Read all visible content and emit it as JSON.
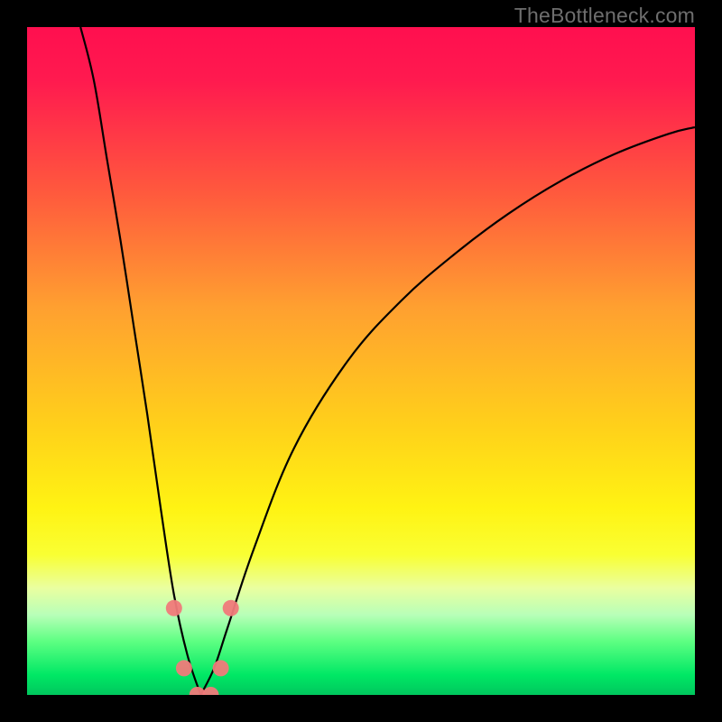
{
  "watermark": "TheBottleneck.com",
  "chart_data": {
    "type": "line",
    "title": "",
    "xlabel": "",
    "ylabel": "",
    "xlim": [
      0,
      100
    ],
    "ylim": [
      0,
      100
    ],
    "curve_type": "bottleneck-v-curve",
    "min_point_percent": 26,
    "left_branch": [
      {
        "x": 8,
        "y": 100
      },
      {
        "x": 10,
        "y": 92
      },
      {
        "x": 12,
        "y": 80
      },
      {
        "x": 14,
        "y": 68
      },
      {
        "x": 16,
        "y": 55
      },
      {
        "x": 18,
        "y": 42
      },
      {
        "x": 20,
        "y": 28
      },
      {
        "x": 22,
        "y": 15
      },
      {
        "x": 24,
        "y": 6
      },
      {
        "x": 26,
        "y": 0
      }
    ],
    "right_branch": [
      {
        "x": 26,
        "y": 0
      },
      {
        "x": 28,
        "y": 4
      },
      {
        "x": 30,
        "y": 10
      },
      {
        "x": 34,
        "y": 22
      },
      {
        "x": 40,
        "y": 37
      },
      {
        "x": 48,
        "y": 50
      },
      {
        "x": 56,
        "y": 59
      },
      {
        "x": 64,
        "y": 66
      },
      {
        "x": 72,
        "y": 72
      },
      {
        "x": 80,
        "y": 77
      },
      {
        "x": 88,
        "y": 81
      },
      {
        "x": 96,
        "y": 84
      },
      {
        "x": 100,
        "y": 85
      }
    ],
    "valley_markers": [
      {
        "x": 22,
        "y": 13
      },
      {
        "x": 23.5,
        "y": 4
      },
      {
        "x": 25.5,
        "y": 0
      },
      {
        "x": 27.5,
        "y": 0
      },
      {
        "x": 29.0,
        "y": 4
      },
      {
        "x": 30.5,
        "y": 13
      }
    ],
    "gradient_stops": [
      {
        "offset": 0.0,
        "color": "#ff0f4f"
      },
      {
        "offset": 0.08,
        "color": "#ff1a4f"
      },
      {
        "offset": 0.25,
        "color": "#ff5a3d"
      },
      {
        "offset": 0.42,
        "color": "#ffa030"
      },
      {
        "offset": 0.6,
        "color": "#ffd11a"
      },
      {
        "offset": 0.72,
        "color": "#fff313"
      },
      {
        "offset": 0.79,
        "color": "#f9ff33"
      },
      {
        "offset": 0.84,
        "color": "#eaffa0"
      },
      {
        "offset": 0.88,
        "color": "#b8ffb8"
      },
      {
        "offset": 0.92,
        "color": "#5dff82"
      },
      {
        "offset": 0.97,
        "color": "#00e865"
      },
      {
        "offset": 1.0,
        "color": "#00c75d"
      }
    ]
  }
}
